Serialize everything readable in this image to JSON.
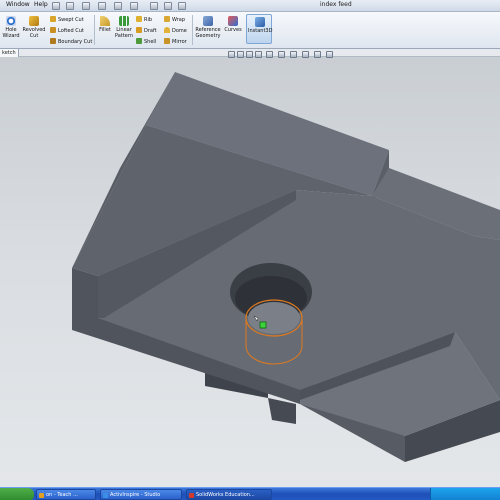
{
  "menubar": {
    "items": [
      {
        "label": "Window"
      },
      {
        "label": "Help"
      }
    ],
    "document_title": "index feed"
  },
  "ribbon": {
    "hole_wizard": "Hole\nWizard",
    "revolved_cut": "Revolved\nCut",
    "swept_cut": "Swept Cut",
    "lofted_cut": "Lofted Cut",
    "boundary_cut": "Boundary Cut",
    "fillet": "Fillet",
    "linear_pattern": "Linear\nPattern",
    "rib": "Rib",
    "draft": "Draft",
    "shell": "Shell",
    "wrap": "Wrap",
    "dome": "Dome",
    "mirror": "Mirror",
    "reference_geometry": "Reference\nGeometry",
    "curves": "Curves",
    "instant3d": "Instant3D"
  },
  "tabstrip": {
    "active_tab": "ketch"
  },
  "taskbar": {
    "start_label": "",
    "tasks": [
      {
        "label": "on - Teach ...",
        "color": "#e0a020"
      },
      {
        "label": "ActivInspire - Studio",
        "color": "#3a8ee6"
      },
      {
        "label": "SolidWorks Education...",
        "color": "#d23b2a"
      }
    ]
  },
  "colors": {
    "model_top": "#6c717b",
    "model_side": "#50545d",
    "model_dark": "#3f434b",
    "selection": "#e07a1f",
    "accent": "#2458c2"
  }
}
